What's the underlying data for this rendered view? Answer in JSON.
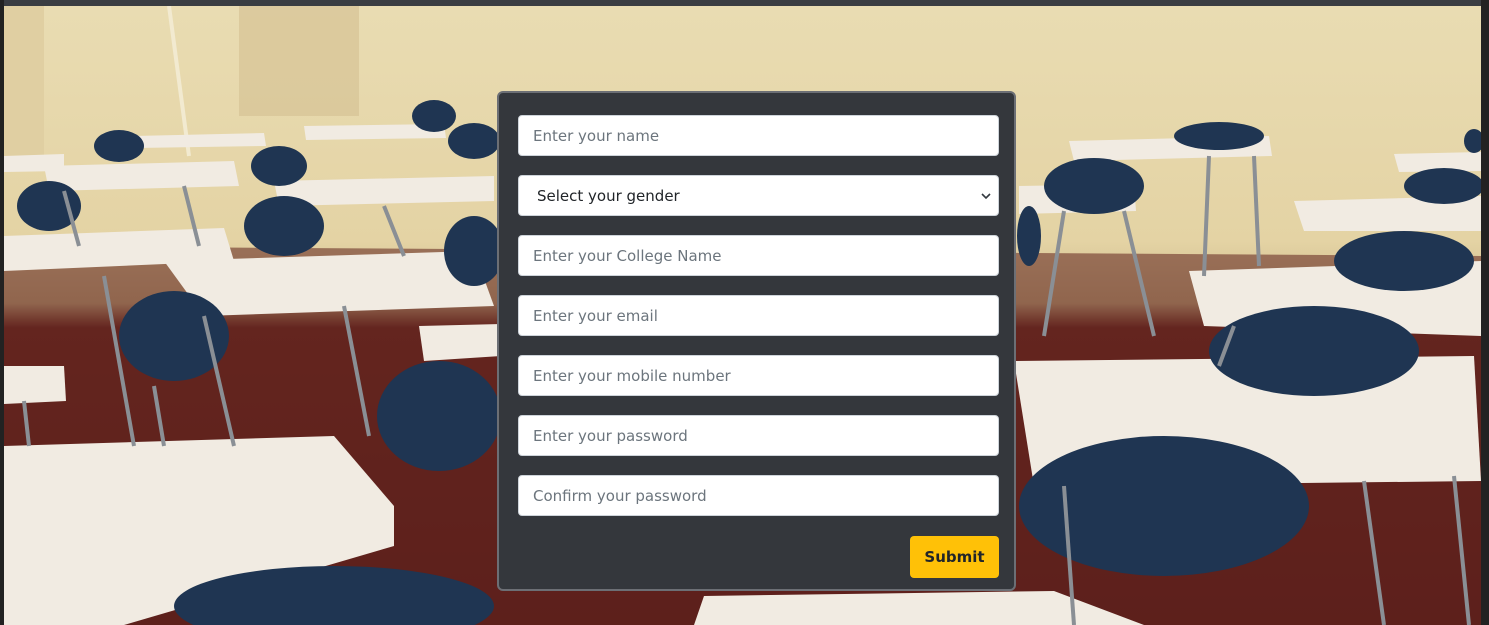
{
  "form": {
    "name_placeholder": "Enter your name",
    "gender_select": {
      "selected": "Select your gender",
      "options": [
        "Select your gender"
      ]
    },
    "college_placeholder": "Enter your College Name",
    "email_placeholder": "Enter your email",
    "mobile_placeholder": "Enter your mobile number",
    "password_placeholder": "Enter your password",
    "confirm_password_placeholder": "Confirm your password",
    "submit_label": "Submit"
  },
  "colors": {
    "card_background": "#34373c",
    "submit_button": "#ffc107"
  }
}
